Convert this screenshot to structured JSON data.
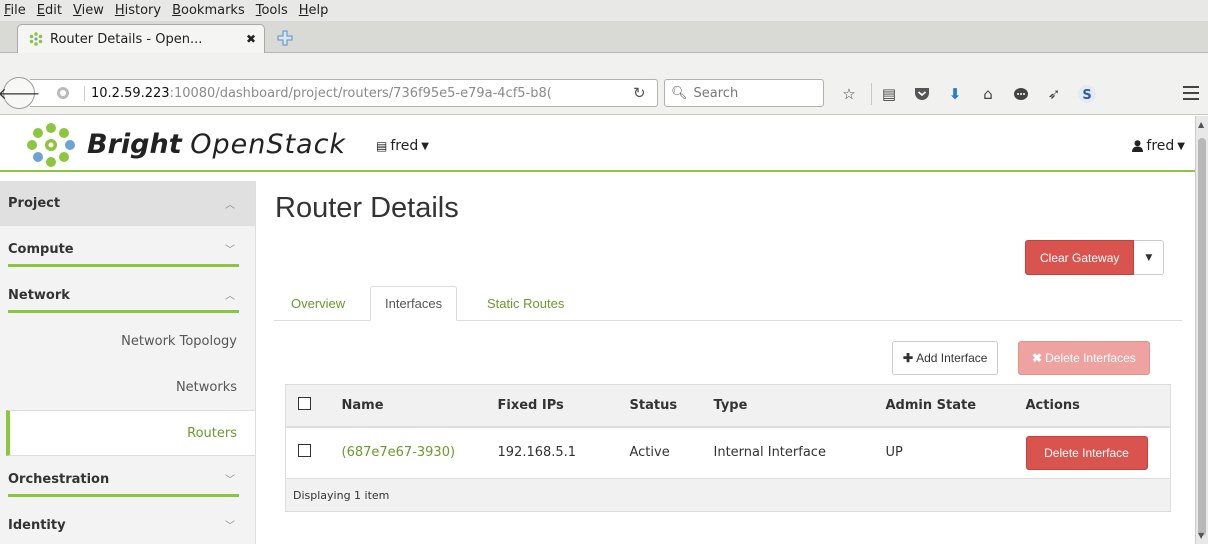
{
  "browser": {
    "menu": [
      "File",
      "Edit",
      "View",
      "History",
      "Bookmarks",
      "Tools",
      "Help"
    ],
    "tab_title": "Router Details - Open...",
    "tab_close": "✖",
    "url_host": "10.2.59.223",
    "url_rest": ":10080/dashboard/project/routers/736f95e5-e79a-4cf5-b8(",
    "search_placeholder": "Search"
  },
  "header": {
    "brand_bold": "Bright",
    "brand_light": "OpenStack",
    "project": "fred",
    "user": "fred"
  },
  "sidebar": {
    "project": "Project",
    "compute": "Compute",
    "network": "Network",
    "items": [
      "Network Topology",
      "Networks",
      "Routers"
    ],
    "orchestration": "Orchestration",
    "identity": "Identity"
  },
  "main": {
    "title": "Router Details",
    "clear_gateway": "Clear Gateway",
    "tabs": [
      "Overview",
      "Interfaces",
      "Static Routes"
    ],
    "add_interface": "Add Interface",
    "delete_interfaces": "Delete Interfaces",
    "table": {
      "headers": [
        "Name",
        "Fixed IPs",
        "Status",
        "Type",
        "Admin State",
        "Actions"
      ],
      "row": {
        "name": "(687e7e67-3930)",
        "fixed_ips": "192.168.5.1",
        "status": "Active",
        "type": "Internal Interface",
        "admin_state": "UP",
        "action": "Delete Interface"
      },
      "footer": "Displaying 1 item"
    }
  },
  "colors": {
    "accent": "#8cc63f",
    "link": "#6a9a2d",
    "danger": "#d9534f"
  }
}
